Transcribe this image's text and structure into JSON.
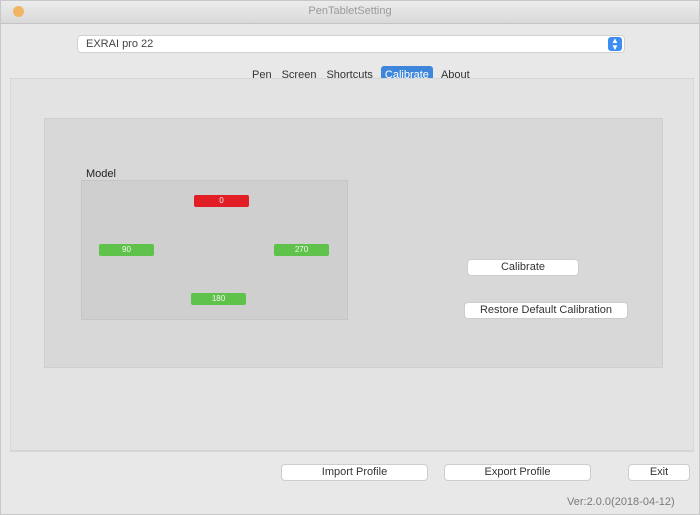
{
  "window": {
    "title": "PenTabletSetting"
  },
  "device_select": {
    "value": "EXRAI pro 22"
  },
  "tabs": [
    {
      "label": "Pen"
    },
    {
      "label": "Screen"
    },
    {
      "label": "Shortcuts"
    },
    {
      "label": "Calibrate",
      "active": true
    },
    {
      "label": "About"
    }
  ],
  "model": {
    "label": "Model",
    "markers": {
      "top": "0",
      "left": "90",
      "right": "270",
      "bottom": "180"
    }
  },
  "buttons": {
    "calibrate": "Calibrate",
    "restore": "Restore Default Calibration",
    "import": "Import Profile",
    "export": "Export Profile",
    "exit": "Exit"
  },
  "version": "Ver:2.0.0(2018-04-12)",
  "colors": {
    "accent": "#3e86d9",
    "active_marker": "#e11e25",
    "inactive_marker": "#5fc24b"
  }
}
